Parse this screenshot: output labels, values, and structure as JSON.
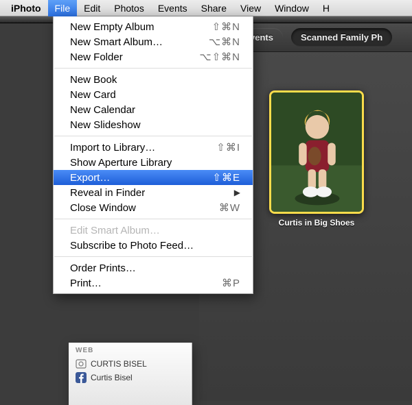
{
  "menubar": {
    "app": "iPhoto",
    "items": [
      "File",
      "Edit",
      "Photos",
      "Events",
      "Share",
      "View",
      "Window",
      "H"
    ],
    "active_index": 0
  },
  "dropdown": {
    "groups": [
      [
        {
          "label": "New Empty Album",
          "shortcut": "⇧⌘N"
        },
        {
          "label": "New Smart Album…",
          "shortcut": "⌥⌘N"
        },
        {
          "label": "New Folder",
          "shortcut": "⌥⇧⌘N"
        }
      ],
      [
        {
          "label": "New Book"
        },
        {
          "label": "New Card"
        },
        {
          "label": "New Calendar"
        },
        {
          "label": "New Slideshow"
        }
      ],
      [
        {
          "label": "Import to Library…",
          "shortcut": "⇧⌘I"
        },
        {
          "label": "Show Aperture Library"
        },
        {
          "label": "Export…",
          "shortcut": "⇧⌘E",
          "highlight": true
        },
        {
          "label": "Reveal in Finder",
          "submenu": true
        },
        {
          "label": "Close Window",
          "shortcut": "⌘W"
        }
      ],
      [
        {
          "label": "Edit Smart Album…",
          "disabled": true
        },
        {
          "label": "Subscribe to Photo Feed…"
        }
      ],
      [
        {
          "label": "Order Prints…"
        },
        {
          "label": "Print…",
          "shortcut": "⌘P"
        }
      ]
    ]
  },
  "tabs": {
    "items": [
      "vents",
      "Scanned Family Ph"
    ],
    "selected_index": 1
  },
  "photo": {
    "caption": "Curtis in Big Shoes"
  },
  "sidebar_web": {
    "heading": "WEB",
    "items": [
      {
        "label": "CURTIS BISEL",
        "icon": "mobileme"
      },
      {
        "label": "Curtis Bisel",
        "icon": "facebook"
      }
    ]
  }
}
